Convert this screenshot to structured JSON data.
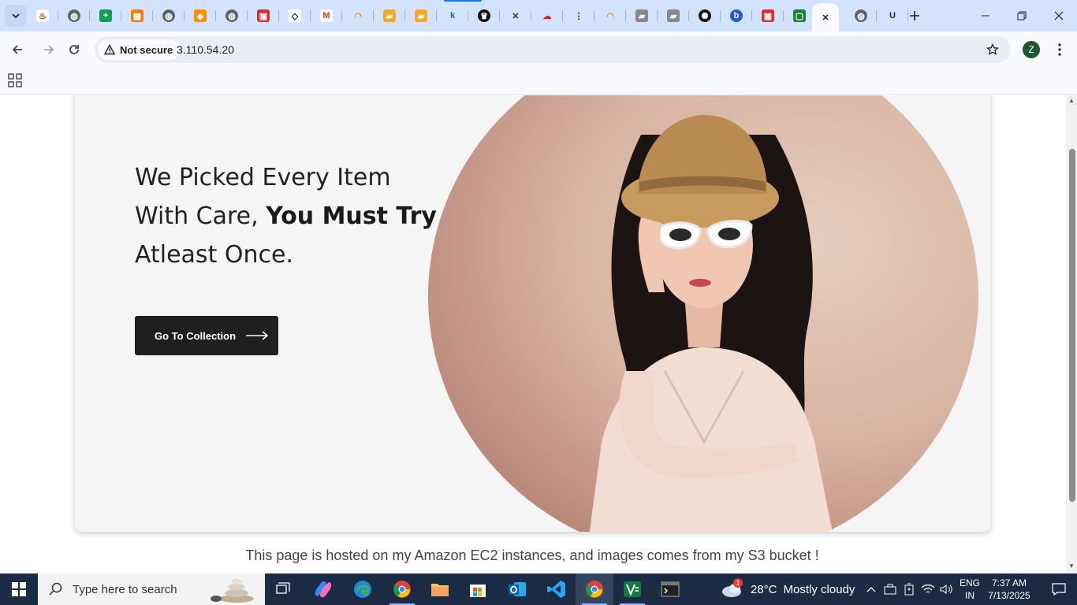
{
  "browser": {
    "tabs": [
      {
        "icon": "food-logo-icon"
      },
      {
        "icon": "globe-icon"
      },
      {
        "icon": "sheets-plus-icon"
      },
      {
        "icon": "orange-grid-icon"
      },
      {
        "icon": "globe-icon"
      },
      {
        "icon": "orange-box-icon"
      },
      {
        "icon": "globe-icon"
      },
      {
        "icon": "red-card-icon"
      },
      {
        "icon": "codepen-icon"
      },
      {
        "icon": "gmail-icon"
      },
      {
        "icon": "orange-ring-icon"
      },
      {
        "icon": "orange-book-icon"
      },
      {
        "icon": "orange-book-icon"
      },
      {
        "icon": "k-logo-icon"
      },
      {
        "icon": "dark-crown-icon"
      },
      {
        "icon": "x-logo-icon"
      },
      {
        "icon": "cloud-link-icon"
      },
      {
        "icon": "cisco-icon"
      },
      {
        "icon": "orange-ring-icon"
      },
      {
        "icon": "gray-book-icon"
      },
      {
        "icon": "gray-book-icon"
      },
      {
        "icon": "openai-icon"
      },
      {
        "icon": "b-circle-icon"
      },
      {
        "icon": "red-card-icon"
      },
      {
        "icon": "green-square-icon"
      },
      {
        "icon": "close-icon",
        "active": true
      },
      {
        "icon": "globe-icon"
      },
      {
        "icon": "u-logo-icon"
      }
    ],
    "security_label": "Not secure",
    "url": "3.110.54.20",
    "profile_initial": "Z"
  },
  "page": {
    "headline_part1": "We Picked Every Item With Care, ",
    "headline_bold": "You Must Try",
    "headline_part2": " Atleast Once.",
    "cta_label": "Go To Collection",
    "footer_note": "This page is hosted on my Amazon EC2 instances, and images comes from my S3 bucket !"
  },
  "taskbar": {
    "search_placeholder": "Type here to search",
    "weather_temp": "28°C",
    "weather_desc": "Mostly cloudy",
    "weather_badge": "1",
    "lang_line1": "ENG",
    "lang_line2": "IN",
    "time": "7:37 AM",
    "date": "7/13/2025"
  },
  "colors": {
    "tabstrip": "#d3e3fd",
    "toolbar": "#f8fafd",
    "cta": "#1f1f1f",
    "taskbar": "#1c2b44"
  }
}
